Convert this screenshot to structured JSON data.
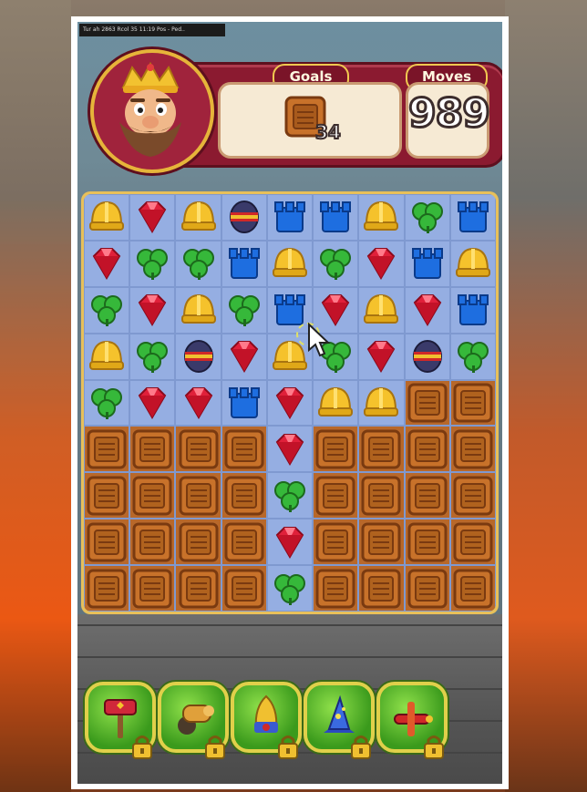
{
  "debug_text": "Tur ah 2863 Rcol 35  11:19 Pos - Ped..",
  "hud": {
    "goals_label": "Goals",
    "moves_label": "Moves",
    "moves_value": "989",
    "goal_count": "34",
    "goal_item": "crate"
  },
  "board": {
    "rows": [
      [
        "helmet",
        "ruby",
        "helmet",
        "bomb",
        "tower",
        "tower",
        "helmet",
        "clover",
        "tower"
      ],
      [
        "ruby",
        "clover",
        "clover",
        "tower",
        "helmet",
        "clover",
        "ruby",
        "tower",
        "helmet"
      ],
      [
        "clover",
        "ruby",
        "helmet",
        "clover",
        "tower",
        "ruby",
        "helmet",
        "ruby",
        "tower"
      ],
      [
        "helmet",
        "clover",
        "bomb",
        "ruby",
        "helmet",
        "clover",
        "ruby",
        "bomb",
        "clover"
      ],
      [
        "clover",
        "ruby",
        "ruby",
        "tower",
        "ruby",
        "helmet",
        "helmet",
        "crate",
        "crate"
      ],
      [
        "crate",
        "crate",
        "crate",
        "crate",
        "ruby",
        "crate",
        "crate",
        "crate",
        "crate"
      ],
      [
        "crate",
        "crate",
        "crate",
        "crate",
        "clover",
        "crate",
        "crate",
        "crate",
        "crate"
      ],
      [
        "crate",
        "crate",
        "crate",
        "crate",
        "ruby",
        "crate",
        "crate",
        "crate",
        "crate"
      ],
      [
        "crate",
        "crate",
        "crate",
        "crate",
        "clover",
        "crate",
        "crate",
        "crate",
        "crate"
      ]
    ]
  },
  "boosters": [
    {
      "name": "hammer",
      "locked": true
    },
    {
      "name": "cannon",
      "locked": true
    },
    {
      "name": "rocket",
      "locked": true
    },
    {
      "name": "wizard-hat",
      "locked": true
    },
    {
      "name": "airplane",
      "locked": true
    }
  ],
  "colors": {
    "hud_band": "#8b1a30",
    "board_bg": "#95aee2",
    "booster_green": "#3a9a1c",
    "gold": "#e6b43a"
  }
}
